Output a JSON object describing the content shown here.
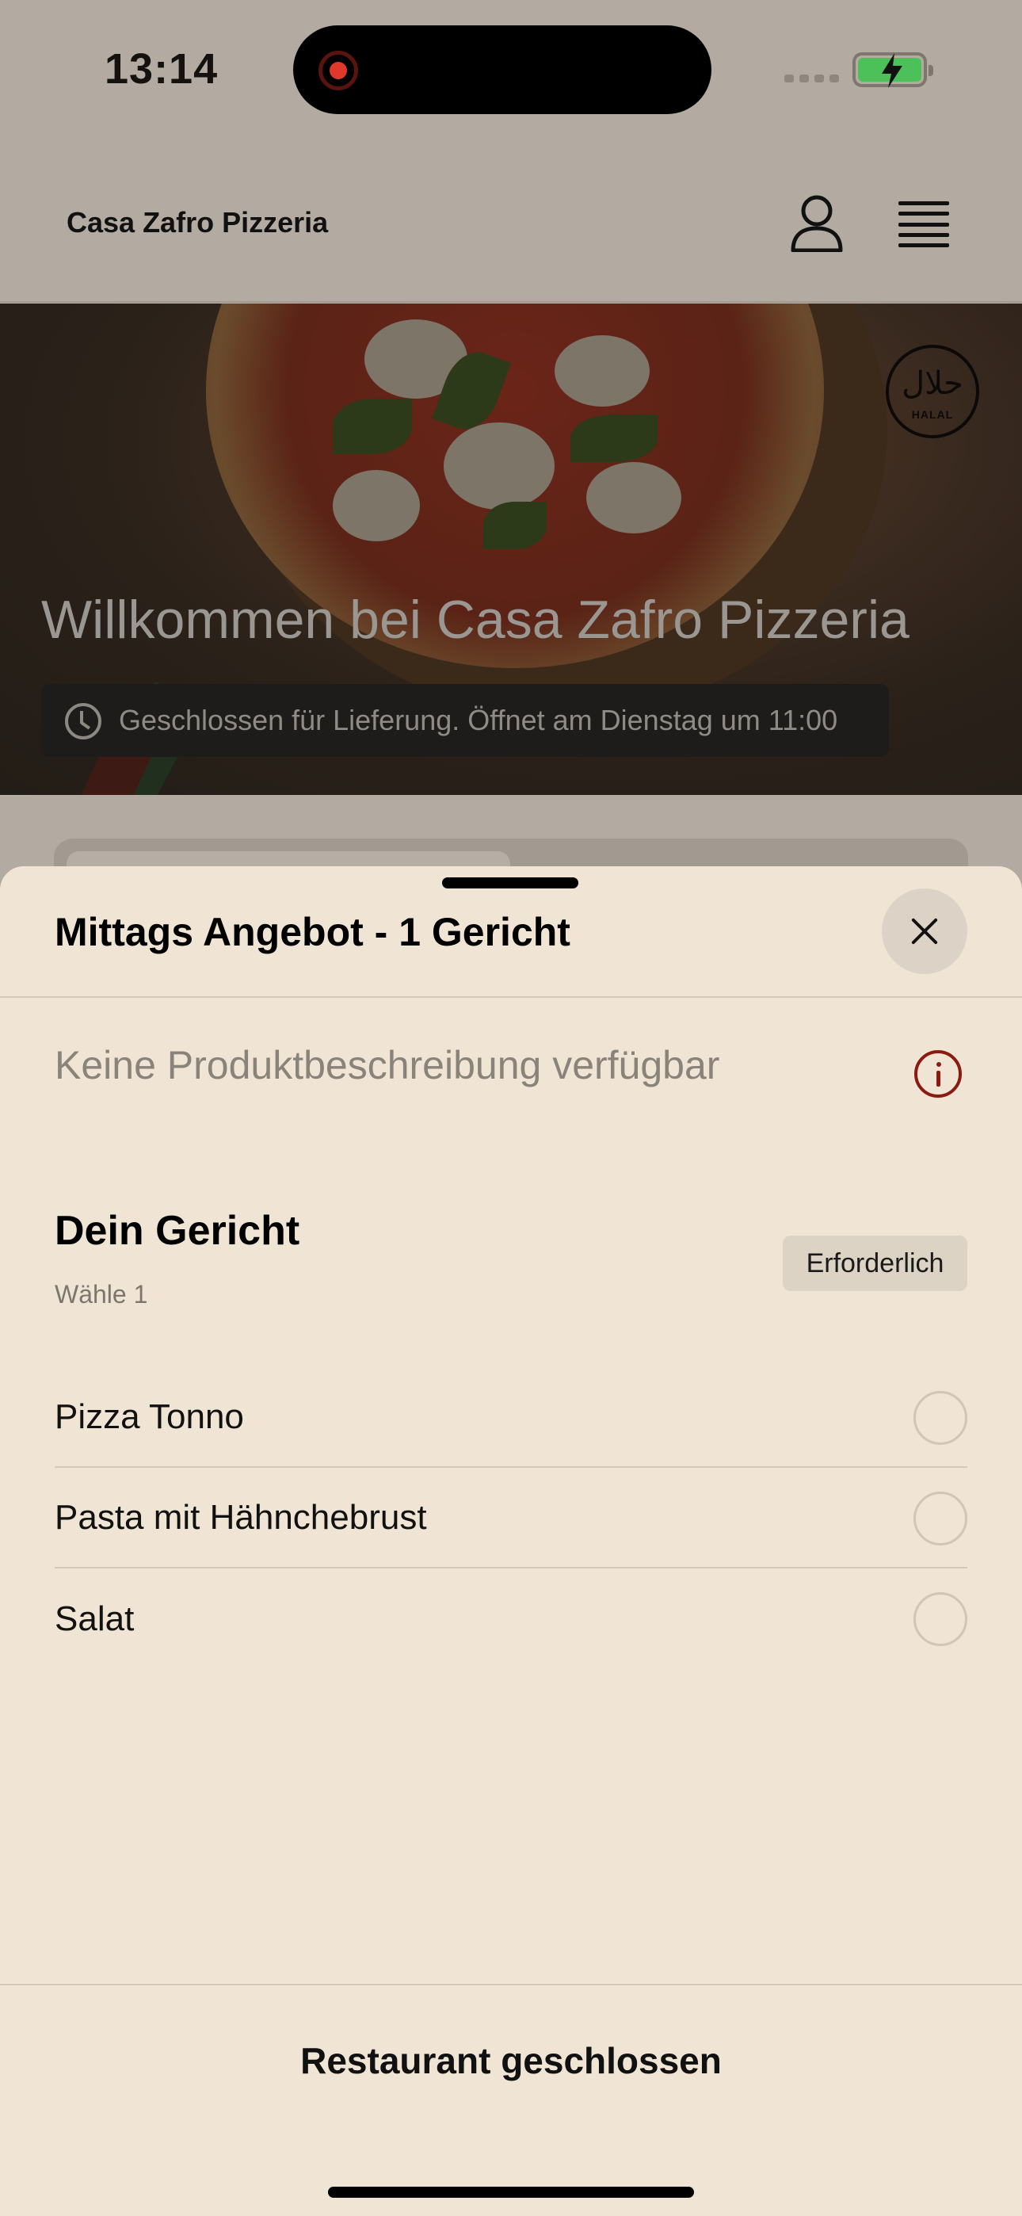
{
  "status_bar": {
    "time": "13:14"
  },
  "header": {
    "brand": "Casa Zafro Pizzeria"
  },
  "hero": {
    "title": "Willkommen bei Casa Zafro Pizzeria",
    "status": "Geschlossen für Lieferung. Öffnet am Dienstag um 11:00",
    "halal_arabic": "حلال",
    "halal_label": "HALAL"
  },
  "sheet": {
    "title": "Mittags Angebot - 1 Gericht",
    "description": "Keine Produktbeschreibung verfügbar",
    "group": {
      "title": "Dein Gericht",
      "subtitle": "Wähle 1",
      "badge": "Erforderlich",
      "options": [
        {
          "label": "Pizza Tonno",
          "selected": false
        },
        {
          "label": "Pasta mit Hähnchebrust",
          "selected": false
        },
        {
          "label": "Salat",
          "selected": false
        }
      ]
    },
    "footer_button": "Restaurant geschlossen"
  },
  "colors": {
    "sheet_bg": "#f0e5d5",
    "overlay_bg": "#b3aba1",
    "info_accent": "#8b1a10",
    "battery_green": "#4cc15a"
  },
  "icons": [
    "record-icon",
    "signal-icon",
    "battery-icon",
    "user-icon",
    "menu-icon",
    "halal-icon",
    "clock-icon",
    "close-icon",
    "info-icon"
  ]
}
